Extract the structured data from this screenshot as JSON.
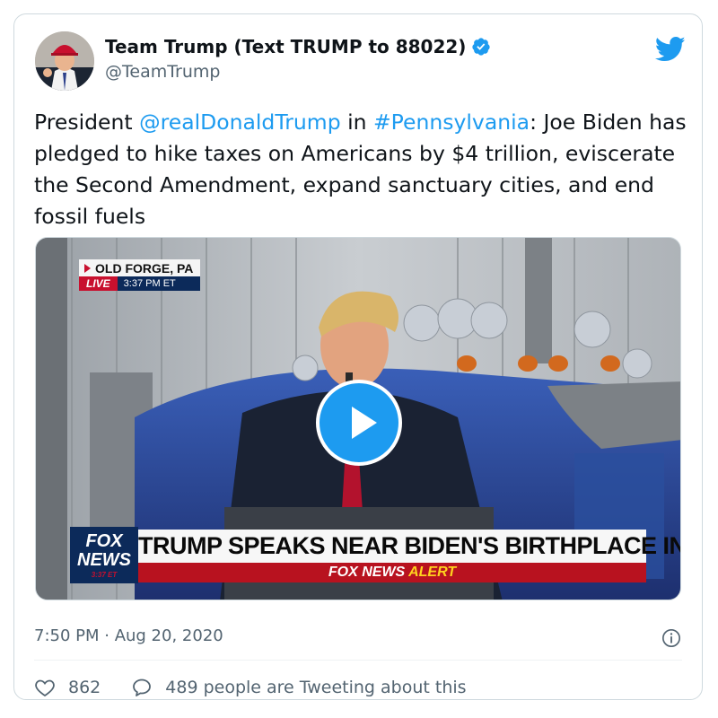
{
  "author": {
    "name": "Team Trump (Text TRUMP to 88022)",
    "handle": "@TeamTrump",
    "verified": true
  },
  "tweet": {
    "text_parts": [
      {
        "text": "President ",
        "type": "text"
      },
      {
        "text": "@realDonaldTrump",
        "type": "mention"
      },
      {
        "text": " in ",
        "type": "text"
      },
      {
        "text": "#Pennsylvania",
        "type": "hashtag"
      },
      {
        "text": ": Joe Biden has pledged to hike taxes on Americans by $4 trillion, eviscerate the Second Amendment, expand sanctuary cities, and end fossil fuels",
        "type": "text"
      }
    ]
  },
  "media": {
    "location": "OLD FORGE, PA",
    "live_label": "LIVE",
    "live_time": "3:37 PM ET",
    "network_line1": "FOX",
    "network_line2": "NEWS",
    "network_line3": "3:37 ET",
    "headline": "TRUMP SPEAKS NEAR BIDEN'S BIRTHPLACE IN PA",
    "alert_network": "FOX NEWS",
    "alert_word": "ALERT"
  },
  "timestamp": "7:50 PM · Aug 20, 2020",
  "actions": {
    "likes": "862",
    "reply_text": "489 people are Tweeting about this"
  },
  "colors": {
    "link": "#1d9bf0",
    "verified": "#1d9bf0",
    "fox_red": "#c8102e",
    "fox_navy": "#0c2a5a"
  },
  "icons": [
    "verified-badge-icon",
    "twitter-bird-icon",
    "play-icon",
    "info-icon",
    "heart-icon",
    "speech-bubble-icon"
  ]
}
